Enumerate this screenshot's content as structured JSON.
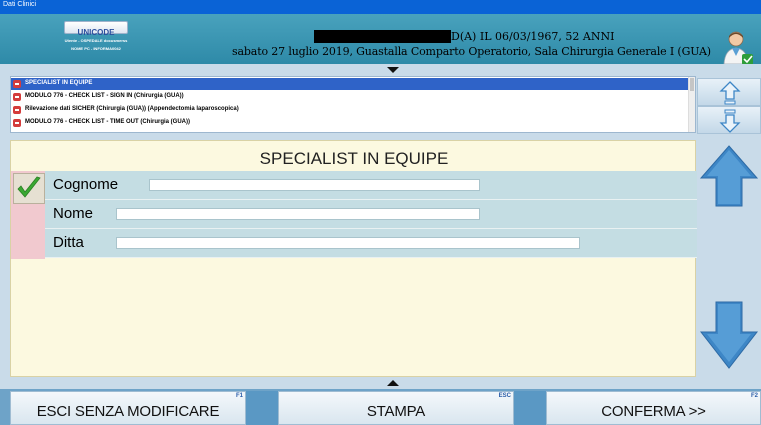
{
  "window": {
    "title": "Dati Clinici"
  },
  "header": {
    "logo_text": "UNICODE",
    "hospital_line1": "Utente - OSPEDALE docusmerss",
    "hospital_line2": "NOME PC - INFORMA0042",
    "patient_info": "D(A) IL 06/03/1967, 52 ANNI",
    "session_info": "sabato 27 luglio 2019, Guastalla Comparto Operatorio, Sala Chirurgia Generale I (GUA)",
    "user_icon": "doctor-icon"
  },
  "modules": [
    {
      "label": "SPECIALIST IN EQUIPE",
      "selected": true
    },
    {
      "label": "MODULO 776 - CHECK LIST - SIGN IN (Chirurgia (GUA))",
      "selected": false
    },
    {
      "label": "Rilevazione dati SICHER (Chirurgia (GUA)) (Appendectomia laparoscopica)",
      "selected": false
    },
    {
      "label": "MODULO 776 - CHECK LIST - TIME OUT (Chirurgia (GUA))",
      "selected": false
    }
  ],
  "panel": {
    "title": "SPECIALIST IN EQUIPE",
    "checked": true,
    "fields": [
      {
        "label": "Cognome",
        "value": ""
      },
      {
        "label": "Nome",
        "value": ""
      },
      {
        "label": "Ditta",
        "value": ""
      }
    ]
  },
  "footer": {
    "exit_label": "ESCI SENZA MODIFICARE",
    "exit_key": "F1",
    "print_label": "STAMPA",
    "print_key": "ESC",
    "confirm_label": "CONFERMA >>",
    "confirm_key": "F2"
  },
  "colors": {
    "titlebar": "#0a63d6",
    "header": "#3a93b0",
    "selected_row": "#2f63c8",
    "arrow_blue": "#3d86c6",
    "panel_bg": "#fcf9e0",
    "field_row": "#c4dde3",
    "check_green": "#3aa832"
  }
}
